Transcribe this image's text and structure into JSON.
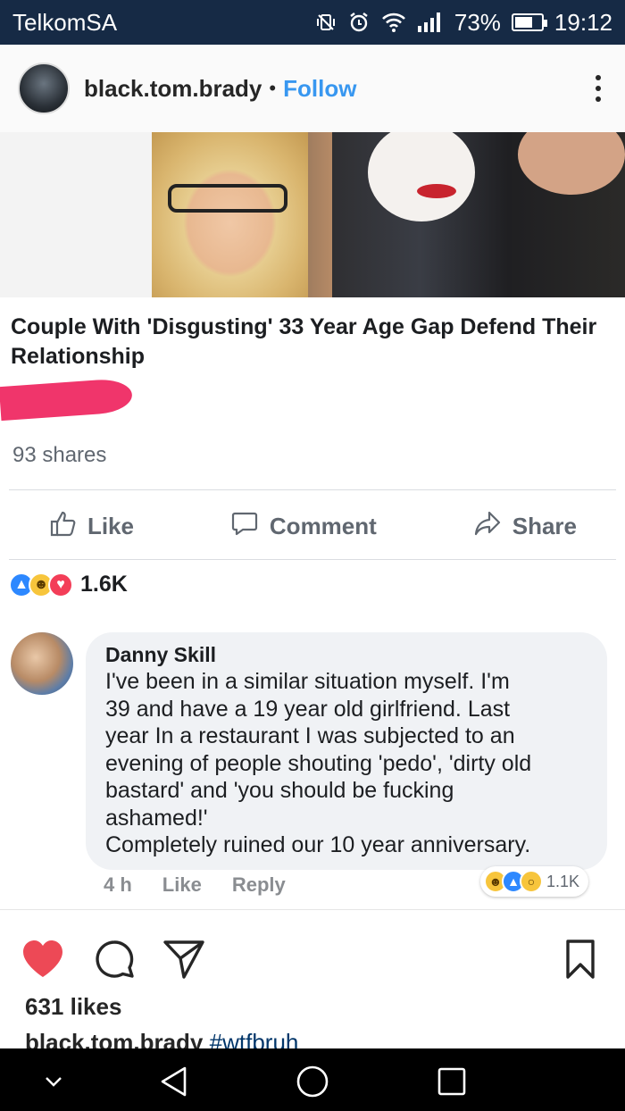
{
  "status_bar": {
    "carrier": "TelkomSA",
    "battery": "73%",
    "battery_level": 0.73,
    "time": "19:12",
    "icons": [
      "vibrate-icon",
      "alarm-icon",
      "wifi-icon",
      "signal-icon",
      "battery-icon"
    ]
  },
  "header": {
    "username": "black.tom.brady",
    "separator": "•",
    "follow_label": "Follow"
  },
  "post": {
    "headline": "Couple With 'Disgusting' 33 Year Age Gap Defend Their Relationship",
    "shares": "93 shares",
    "actions": {
      "like": "Like",
      "comment": "Comment",
      "share": "Share"
    },
    "reaction_count": "1.6K",
    "reaction_icons": [
      "like-reaction-icon",
      "haha-reaction-icon",
      "love-reaction-icon"
    ],
    "redaction_color": "#f0356b"
  },
  "comment": {
    "author": "Danny Skill",
    "text": "I've been in a similar situation  myself. I'm\n39 and have a 19 year old girlfriend. Last\nyear In a restaurant I was subjected to an\nevening of people shouting 'pedo', 'dirty old\nbastard' and 'you should be fucking\nashamed!'\nCompletely ruined our 10 year anniversary.",
    "time": "4 h",
    "like_label": "Like",
    "reply_label": "Reply",
    "reaction_count": "1.1K",
    "reaction_icons": [
      "haha-reaction-icon",
      "like-reaction-icon",
      "wow-reaction-icon"
    ]
  },
  "instagram": {
    "likes": "631 likes",
    "caption_user": "black.tom.brady",
    "caption_tag": "#wtfbruh",
    "heart_color": "#ed4956",
    "icons": [
      "heart-icon",
      "comment-icon",
      "direct-share-icon",
      "bookmark-icon"
    ]
  },
  "navbar": {
    "icons": [
      "collapse-chevron-icon",
      "back-icon",
      "home-icon",
      "recents-icon"
    ]
  }
}
